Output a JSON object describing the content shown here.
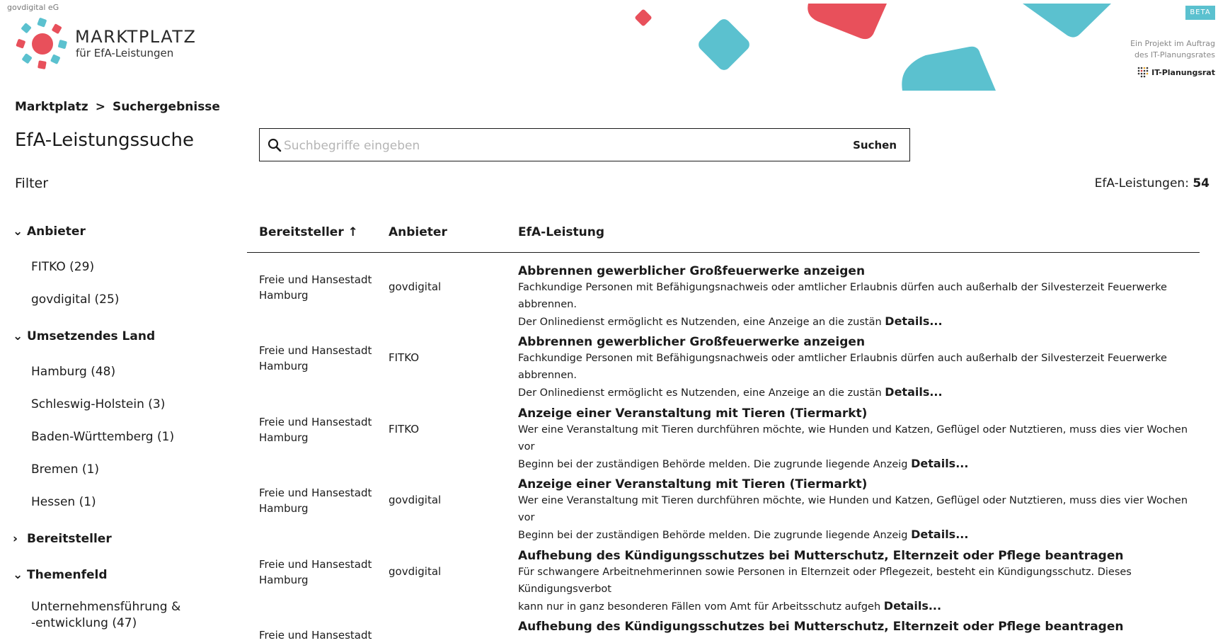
{
  "header": {
    "org": "govdigital eG",
    "logo_title": "MARKTPLATZ",
    "logo_subtitle": "für EfA-Leistungen",
    "beta": "BETA",
    "auftrag_line1": "Ein Projekt im Auftrag",
    "auftrag_line2": "des IT-Planungsrates",
    "itpr": "IT-Planungsrat",
    "colors": {
      "red": "#e8505b",
      "blue": "#5bc1cf"
    }
  },
  "breadcrumb": {
    "items": [
      "Marktplatz",
      "Suchergebnisse"
    ],
    "separator": ">"
  },
  "page_title": "EfA-Leistungssuche",
  "search": {
    "placeholder": "Suchbegriffe eingeben",
    "button": "Suchen"
  },
  "filter_label": "Filter",
  "result_count": {
    "label": "EfA-Leistungen:",
    "value": "54"
  },
  "filters": [
    {
      "title": "Anbieter",
      "expanded": true,
      "items": [
        "FITKO (29)",
        "govdigital (25)"
      ]
    },
    {
      "title": "Umsetzendes Land",
      "expanded": true,
      "items": [
        "Hamburg (48)",
        "Schleswig-Holstein (3)",
        "Baden-Württemberg (1)",
        "Bremen (1)",
        "Hessen (1)"
      ]
    },
    {
      "title": "Bereitsteller",
      "expanded": false,
      "items": []
    },
    {
      "title": "Themenfeld",
      "expanded": true,
      "items": [
        "Unternehmensführung &",
        "-entwicklung (47)"
      ]
    }
  ],
  "table": {
    "columns": [
      "Bereitsteller",
      "Anbieter",
      "EfA-Leistung"
    ],
    "sort_indicator": "↑",
    "details_label": "Details...",
    "rows": [
      {
        "provider": [
          "Freie und Hansestadt",
          "Hamburg"
        ],
        "anbieter": "govdigital",
        "title": "Abbrennen gewerblicher Großfeuerwerke anzeigen",
        "desc1": "Fachkundige Personen mit Befähigungsnachweis oder amtlicher Erlaubnis dürfen auch außerhalb der Silvesterzeit Feuerwerke abbrennen.",
        "desc2": "Der Onlinedienst ermöglicht es Nutzenden, eine Anzeige an die zustän"
      },
      {
        "provider": [
          "Freie und Hansestadt",
          "Hamburg"
        ],
        "anbieter": "FITKO",
        "title": "Abbrennen gewerblicher Großfeuerwerke anzeigen",
        "desc1": "Fachkundige Personen mit Befähigungsnachweis oder amtlicher Erlaubnis dürfen auch außerhalb der Silvesterzeit Feuerwerke abbrennen.",
        "desc2": "Der Onlinedienst ermöglicht es Nutzenden, eine Anzeige an die zustän"
      },
      {
        "provider": [
          "Freie und Hansestadt",
          "Hamburg"
        ],
        "anbieter": "FITKO",
        "title": "Anzeige einer Veranstaltung mit Tieren (Tiermarkt)",
        "desc1": "Wer eine Veranstaltung mit Tieren durchführen möchte, wie Hunden und Katzen, Geflügel oder Nutztieren, muss dies vier Wochen vor",
        "desc2": "Beginn bei der zuständigen Behörde melden. Die zugrunde liegende Anzeig"
      },
      {
        "provider": [
          "Freie und Hansestadt",
          "Hamburg"
        ],
        "anbieter": "govdigital",
        "title": "Anzeige einer Veranstaltung mit Tieren (Tiermarkt)",
        "desc1": "Wer eine Veranstaltung mit Tieren durchführen möchte, wie Hunden und Katzen, Geflügel oder Nutztieren, muss dies vier Wochen vor",
        "desc2": "Beginn bei der zuständigen Behörde melden. Die zugrunde liegende Anzeig"
      },
      {
        "provider": [
          "Freie und Hansestadt",
          "Hamburg"
        ],
        "anbieter": "govdigital",
        "title": "Aufhebung des Kündigungsschutzes bei Mutterschutz, Elternzeit oder Pflege beantragen",
        "desc1": "Für schwangere Arbeitnehmerinnen sowie Personen in Elternzeit oder Pflegezeit, besteht ein Kündigungsschutz. Dieses Kündigungsverbot",
        "desc2": "kann nur in ganz besonderen Fällen vom Amt für Arbeitsschutz aufgeh"
      },
      {
        "provider": [
          "Freie und Hansestadt",
          ""
        ],
        "anbieter": "",
        "title": "Aufhebung des Kündigungsschutzes bei Mutterschutz, Elternzeit oder Pflege beantragen",
        "desc1": "",
        "desc2": ""
      }
    ]
  }
}
